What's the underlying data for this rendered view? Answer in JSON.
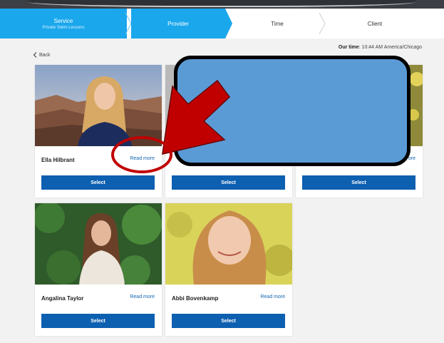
{
  "stepper": {
    "steps": [
      {
        "label": "Service",
        "sub": "Private Swim Lessons"
      },
      {
        "label": "Provider",
        "sub": ""
      },
      {
        "label": "Time",
        "sub": ""
      },
      {
        "label": "Client",
        "sub": ""
      }
    ]
  },
  "header": {
    "time_label": "Our time",
    "time_value": ": 10:44 AM America/Chicago",
    "back_label": "Back"
  },
  "providers": [
    {
      "name": "Ella Hilbrant",
      "read_more": "Read more",
      "select": "Select"
    },
    {
      "name": "",
      "read_more": "",
      "select": "Select"
    },
    {
      "name": "",
      "read_more": "ore",
      "select": "Select"
    },
    {
      "name": "Angalina Taylor",
      "read_more": "Read more",
      "select": "Select"
    },
    {
      "name": "Abbi Bovenkamp",
      "read_more": "Read more",
      "select": "Select"
    }
  ],
  "colors": {
    "active_step": "#1aa7ec",
    "select_button": "#0d5fb0",
    "read_more": "#1565b0",
    "annotation_red": "#c00000",
    "redaction_box": "#5a9bd6"
  }
}
